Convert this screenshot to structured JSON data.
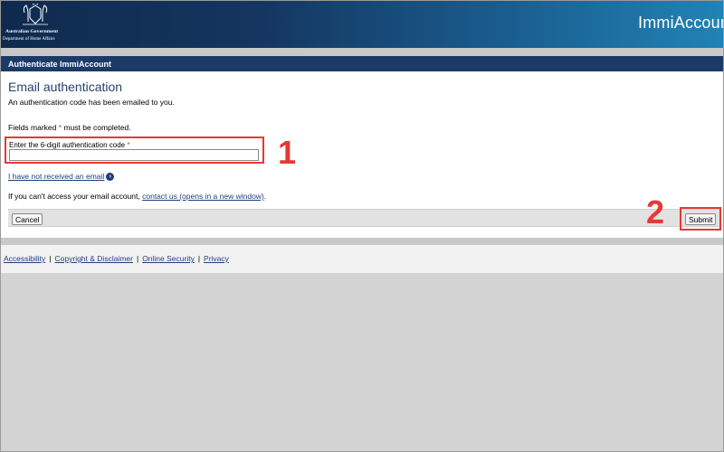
{
  "header": {
    "gov_line1": "Australian Government",
    "gov_line2": "Department of Home Affairs",
    "brand": "ImmiAccount"
  },
  "title_bar": {
    "label": "Authenticate ImmiAccount"
  },
  "main": {
    "heading": "Email authentication",
    "intro": "An authentication code has been emailed to you.",
    "required_prefix": "Fields marked",
    "required_star": "*",
    "required_suffix": "must be completed.",
    "code_field": {
      "label": "Enter the 6-digit authentication code",
      "star": "*",
      "value": ""
    },
    "no_email_link": "I have not received an email",
    "access_prefix": "If you can't access your email account,",
    "contact_link": "contact us (opens in a new window)",
    "access_suffix": "."
  },
  "buttons": {
    "cancel": "Cancel",
    "submit": "Submit"
  },
  "annotations": {
    "marker_1": "1",
    "marker_2": "2",
    "color": "#e53935"
  },
  "footer": {
    "links": [
      "Accessibility",
      "Copyright & Disclaimer",
      "Online Security",
      "Privacy"
    ],
    "separator": "|"
  },
  "colors": {
    "header_start": "#0f2a4e",
    "header_end": "#2183b6",
    "title_bar": "#1b3a66",
    "link": "#1f3f7a"
  }
}
